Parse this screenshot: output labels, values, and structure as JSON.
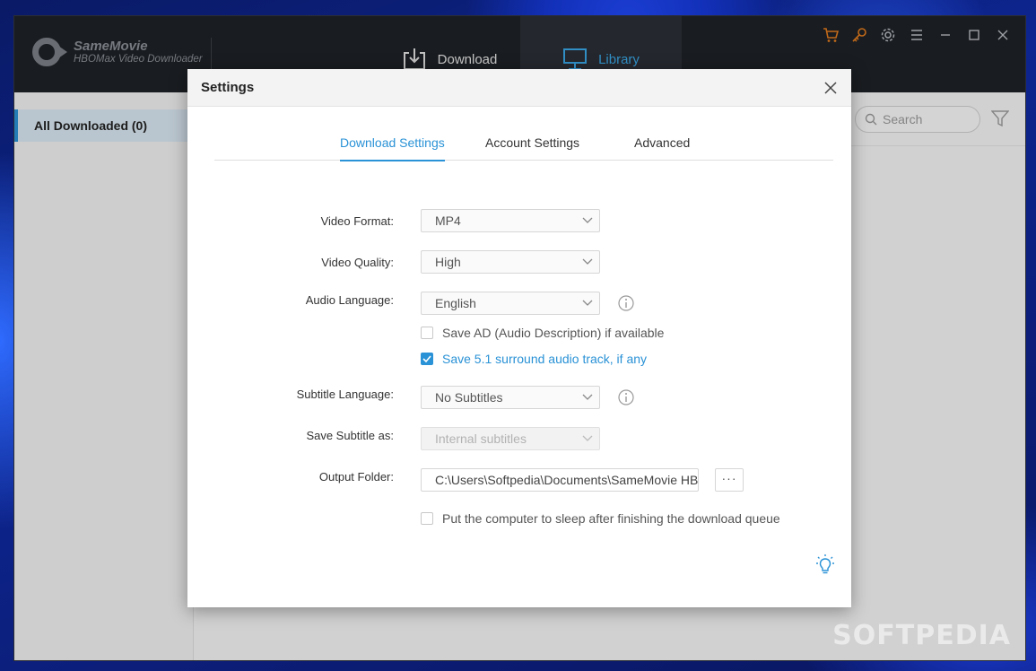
{
  "app": {
    "name": "SameMovie",
    "subtitle": "HBOMax Video Downloader"
  },
  "nav": {
    "download_label": "Download",
    "library_label": "Library"
  },
  "sidebar": {
    "items": [
      {
        "label": "All Downloaded (0)"
      }
    ]
  },
  "toolbar": {
    "search_placeholder": "Search"
  },
  "dialog": {
    "title": "Settings",
    "tabs": [
      {
        "label": "Download Settings",
        "active": true
      },
      {
        "label": "Account Settings",
        "active": false
      },
      {
        "label": "Advanced",
        "active": false
      }
    ],
    "fields": {
      "video_format": {
        "label": "Video Format:",
        "value": "MP4"
      },
      "video_quality": {
        "label": "Video Quality:",
        "value": "High"
      },
      "audio_language": {
        "label": "Audio Language:",
        "value": "English"
      },
      "save_ad": {
        "label": "Save AD (Audio Description) if available",
        "checked": false
      },
      "save_surround": {
        "label": "Save 5.1 surround audio track, if any",
        "checked": true
      },
      "subtitle_language": {
        "label": "Subtitle Language:",
        "value": "No Subtitles"
      },
      "save_subtitle_as": {
        "label": "Save Subtitle as:",
        "value": "Internal subtitles"
      },
      "output_folder": {
        "label": "Output Folder:",
        "value": "C:\\Users\\Softpedia\\Documents\\SameMovie HBOMax Video Downloader",
        "browse_label": "···"
      },
      "sleep_after": {
        "label": "Put the computer to sleep after finishing the download queue",
        "checked": false
      }
    }
  },
  "watermark": "SOFTPEDIA",
  "colors": {
    "accent": "#2a92d6",
    "titlebar": "#1e2126",
    "library_tab": "#3aa7e6",
    "cart_key_icons": "#e07b1f"
  }
}
